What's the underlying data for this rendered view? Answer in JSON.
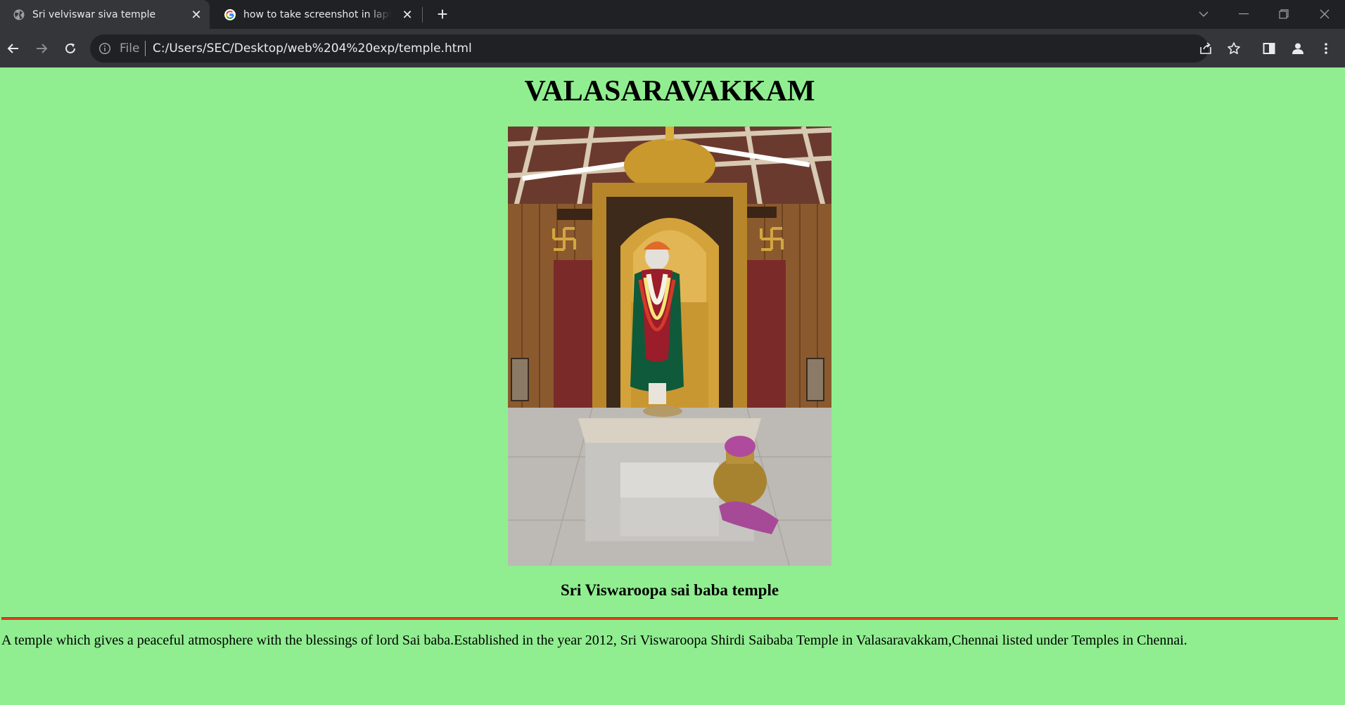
{
  "browser": {
    "tabs": [
      {
        "title": "Sri velviswar siva temple",
        "icon": "globe-icon",
        "active": true
      },
      {
        "title": "how to take screenshot in laptop",
        "icon": "google-icon",
        "active": false
      }
    ],
    "omnibox": {
      "scheme_label": "File",
      "url": "C:/Users/SEC/Desktop/web%204%20exp/temple.html"
    },
    "colors": {
      "tabstrip": "#202124",
      "toolbar": "#35363a",
      "text": "#e8eaed"
    }
  },
  "page": {
    "heading": "VALASARAVAKKAM",
    "image_subject": "shrine-photo",
    "caption": "Sri Viswaroopa sai baba temple",
    "description": "A temple which gives a peaceful atmosphere with the blessings of lord Sai baba.Established in the year 2012, Sri Viswaroopa Shirdi Saibaba Temple in Valasaravakkam,Chennai listed under Temples in Chennai.",
    "colors": {
      "background": "#90ee90",
      "rule": "#dd3f23"
    }
  }
}
